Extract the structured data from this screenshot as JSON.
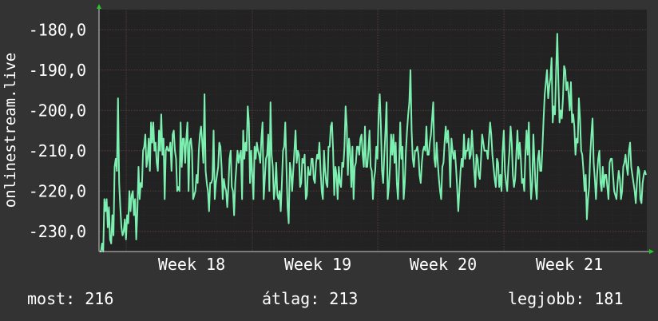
{
  "chart_data": {
    "type": "line",
    "ylabel": "onlinestream.live",
    "x_ticks": [
      "Week 18",
      "Week 19",
      "Week 20",
      "Week 21"
    ],
    "y_ticks": [
      "-180,0",
      "-190,0",
      "-200,0",
      "-210,0",
      "-220,0",
      "-230,0"
    ],
    "ylim": [
      -235,
      -175
    ],
    "grid": true,
    "series": [
      {
        "values": [
          -235,
          -235,
          -233,
          -235,
          -222,
          -225,
          -222,
          -229,
          -224,
          -232,
          -233,
          -226,
          -231,
          -214,
          -212,
          -215,
          -197,
          -218,
          -224,
          -229,
          -231,
          -230,
          -227,
          -232,
          -226,
          -228,
          -220,
          -225,
          -221,
          -220,
          -226,
          -222,
          -232,
          -225,
          -214,
          -222,
          -218,
          -219,
          -210,
          -209,
          -206,
          -214,
          -212,
          -207,
          -215,
          -203,
          -208,
          -203,
          -210,
          -208,
          -213,
          -215,
          -205,
          -210,
          -201,
          -211,
          -207,
          -222,
          -210,
          -209,
          -210,
          -210,
          -208,
          -215,
          -206,
          -205,
          -210,
          -212,
          -220,
          -219,
          -220,
          -203,
          -214,
          -207,
          -207,
          -213,
          -207,
          -203,
          -220,
          -208,
          -207,
          -210,
          -222,
          -221,
          -220,
          -216,
          -218,
          -210,
          -206,
          -204,
          -208,
          -213,
          -196,
          -215,
          -218,
          -220,
          -225,
          -218,
          -218,
          -217,
          -205,
          -222,
          -218,
          -216,
          -214,
          -208,
          -209,
          -214,
          -222,
          -217,
          -219,
          -220,
          -224,
          -219,
          -212,
          -210,
          -219,
          -220,
          -226,
          -218,
          -214,
          -210,
          -213,
          -211,
          -210,
          -222,
          -205,
          -212,
          -208,
          -210,
          -199,
          -203,
          -218,
          -210,
          -216,
          -222,
          -209,
          -212,
          -208,
          -210,
          -211,
          -213,
          -207,
          -203,
          -222,
          -217,
          -212,
          -211,
          -206,
          -220,
          -198,
          -211,
          -214,
          -222,
          -219,
          -213,
          -221,
          -222,
          -220,
          -225,
          -218,
          -210,
          -209,
          -203,
          -214,
          -224,
          -228,
          -213,
          -215,
          -220,
          -215,
          -210,
          -205,
          -213,
          -210,
          -211,
          -219,
          -218,
          -212,
          -213,
          -211,
          -222,
          -221,
          -214,
          -216,
          -216,
          -212,
          -212,
          -217,
          -218,
          -213,
          -211,
          -212,
          -208,
          -215,
          -220,
          -222,
          -210,
          -215,
          -218,
          -219,
          -209,
          -209,
          -204,
          -203,
          -210,
          -221,
          -214,
          -216,
          -222,
          -214,
          -218,
          -219,
          -213,
          -214,
          -209,
          -199,
          -204,
          -216,
          -207,
          -210,
          -219,
          -209,
          -222,
          -214,
          -213,
          -209,
          -209,
          -211,
          -207,
          -206,
          -211,
          -214,
          -204,
          -214,
          -214,
          -210,
          -205,
          -214,
          -215,
          -222,
          -217,
          -215,
          -209,
          -212,
          -201,
          -196,
          -204,
          -215,
          -218,
          -211,
          -205,
          -198,
          -222,
          -219,
          -214,
          -206,
          -211,
          -206,
          -213,
          -208,
          -218,
          -222,
          -214,
          -203,
          -212,
          -209,
          -222,
          -218,
          -210,
          -205,
          -201,
          -198,
          -190,
          -205,
          -212,
          -214,
          -210,
          -210,
          -209,
          -211,
          -216,
          -218,
          -213,
          -210,
          -209,
          -210,
          -204,
          -211,
          -211,
          -208,
          -206,
          -202,
          -198,
          -212,
          -214,
          -208,
          -213,
          -217,
          -220,
          -222,
          -214,
          -213,
          -208,
          -204,
          -208,
          -205,
          -210,
          -219,
          -207,
          -210,
          -212,
          -210,
          -214,
          -219,
          -225,
          -220,
          -215,
          -212,
          -214,
          -206,
          -212,
          -210,
          -210,
          -207,
          -212,
          -211,
          -205,
          -210,
          -215,
          -219,
          -211,
          -212,
          -216,
          -217,
          -212,
          -206,
          -208,
          -210,
          -210,
          -210,
          -212,
          -207,
          -203,
          -206,
          -211,
          -214,
          -217,
          -219,
          -212,
          -213,
          -219,
          -216,
          -220,
          -210,
          -205,
          -215,
          -218,
          -220,
          -214,
          -210,
          -204,
          -208,
          -216,
          -219,
          -217,
          -211,
          -205,
          -212,
          -208,
          -212,
          -218,
          -217,
          -220,
          -211,
          -205,
          -211,
          -203,
          -214,
          -222,
          -218,
          -206,
          -213,
          -219,
          -222,
          -212,
          -210,
          -215,
          -215,
          -209,
          -202,
          -196,
          -193,
          -190,
          -197,
          -194,
          -192,
          -187,
          -203,
          -199,
          -201,
          -190,
          -181,
          -193,
          -203,
          -200,
          -202,
          -197,
          -189,
          -190,
          -195,
          -193,
          -196,
          -200,
          -193,
          -203,
          -201,
          -204,
          -211,
          -207,
          -208,
          -197,
          -202,
          -210,
          -211,
          -215,
          -220,
          -216,
          -227,
          -222,
          -219,
          -211,
          -206,
          -202,
          -213,
          -217,
          -222,
          -216,
          -212,
          -210,
          -218,
          -220,
          -214,
          -219,
          -216,
          -216,
          -219,
          -222,
          -213,
          -212,
          -212,
          -216,
          -220,
          -221,
          -222,
          -218,
          -215,
          -217,
          -222,
          -220,
          -214,
          -213,
          -211,
          -214,
          -216,
          -210,
          -208,
          -214,
          -216,
          -218,
          -220,
          -223,
          -218,
          -214,
          -215,
          -222,
          -223,
          -218,
          -216,
          -215,
          -216
        ]
      }
    ]
  },
  "colors": {
    "background": "#333333",
    "plot_bg": "#222222",
    "line": "#7cf0b0",
    "grid_major": "#503636",
    "grid_minor": "#2a2a2a",
    "axis_arrow": "#22cc22"
  },
  "stats": {
    "current": "most: 216",
    "average": "átlag: 213",
    "best": "legjobb: 181"
  }
}
